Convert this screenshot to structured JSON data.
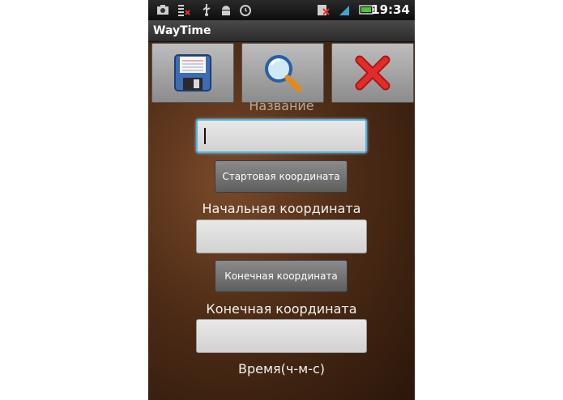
{
  "status_bar": {
    "icons": [
      "camera-icon",
      "sim-blocked-icon",
      "usb-icon",
      "android-debug-icon",
      "alarm-icon",
      "no-sim-icon",
      "signal-icon",
      "battery-icon"
    ],
    "time": "19:34"
  },
  "app": {
    "title": "WayTime"
  },
  "toolbar": {
    "save_icon": "floppy-disk-icon",
    "search_icon": "magnifier-icon",
    "cancel_icon": "red-x-icon"
  },
  "form": {
    "name_label": "Название",
    "name_value": "",
    "start_button": "Стартовая координата",
    "start_label": "Начальная координата",
    "start_value": "",
    "end_button": "Конечная координата",
    "end_label": "Конечная координата",
    "end_value": "",
    "time_label": "Время(ч-м-с)"
  },
  "colors": {
    "focus_border": "#4fb3e6",
    "background": "#4e2c16"
  }
}
